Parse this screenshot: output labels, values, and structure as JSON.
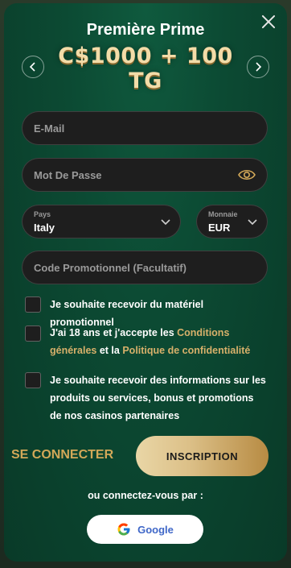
{
  "header": {
    "title": "Première Prime",
    "bonus_text": "C$1000 + 100 TG"
  },
  "form": {
    "email_placeholder": "E-Mail",
    "password_placeholder": "Mot De Passe",
    "country": {
      "label": "Pays",
      "value": "Italy"
    },
    "currency": {
      "label": "Monnaie",
      "value": "EUR"
    },
    "promo_placeholder": "Code Promotionnel (Facultatif)"
  },
  "consents": {
    "promo_materials": "Je souhaite recevoir du matériel promotionnel",
    "age_prefix": "J'ai 18 ans et j'accepte les ",
    "terms_link": "Conditions générales",
    "age_middle": " et la ",
    "privacy_link": "Politique de confidentialité",
    "partners": "Je souhaite recevoir des informations sur les produits ou services, bonus et promotions de nos casinos partenaires"
  },
  "actions": {
    "login_label": "SE CONNECTER",
    "signup_label": "INSCRIPTION",
    "social_prompt": "ou connectez-vous par :",
    "google_label": "Google"
  },
  "colors": {
    "accent_gold": "#d2a858",
    "background_green": "#0c4a33",
    "google_blue": "#3f67c8"
  },
  "icons": [
    "close-icon",
    "chevron-left-icon",
    "chevron-right-icon",
    "eye-icon",
    "chevron-down-icon",
    "google-icon"
  ]
}
